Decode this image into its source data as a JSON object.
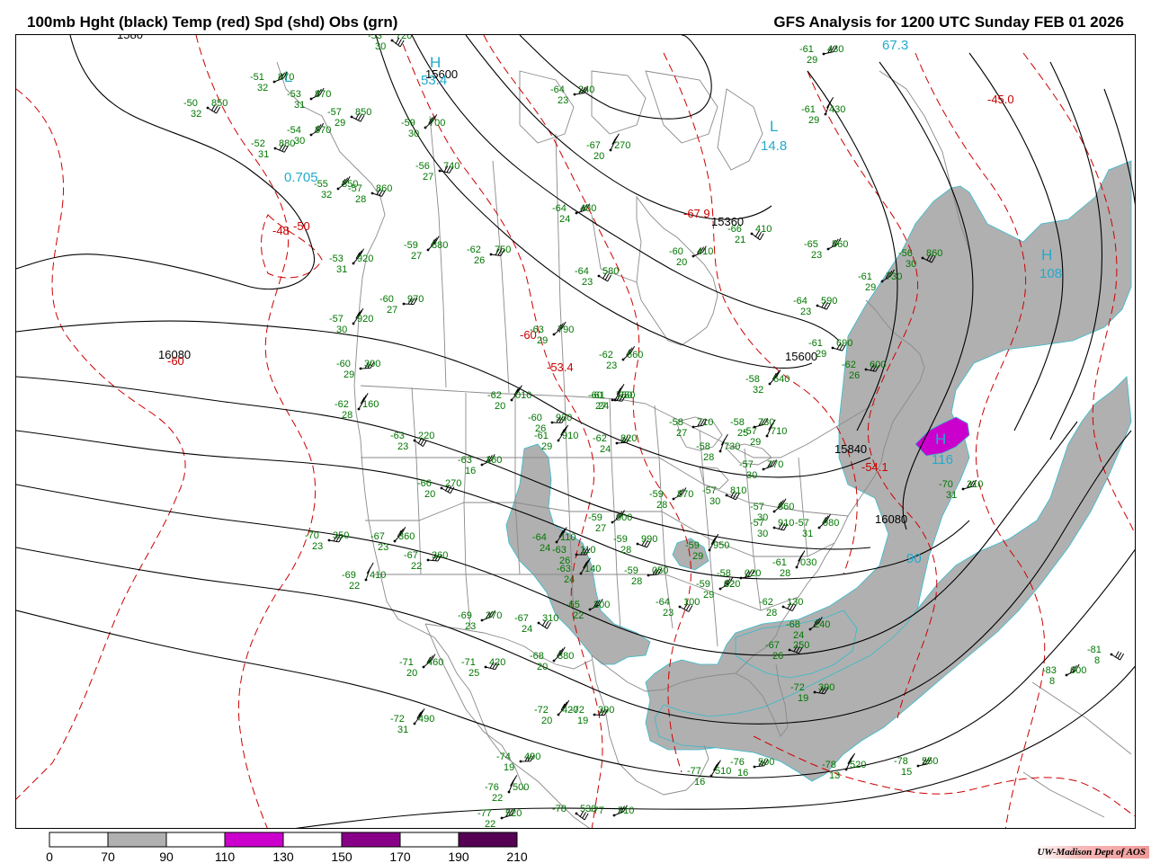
{
  "header": {
    "title_left": "100mb Hght (black) Temp (red) Spd (shd) Obs (grn)",
    "title_right": "GFS Analysis for 1200 UTC Sunday  FEB 01 2026"
  },
  "credit": "UW-Madison  Dept of AOS",
  "colors": {
    "height_contour": "#000000",
    "temp_contour": "#cc0000",
    "obs": "#007700",
    "center_label": "#22aacc",
    "boundaries": "#808080",
    "speed_70_90": "#b0b0b0",
    "speed_110_130": "#cc00cc",
    "speed_150_170": "#880088",
    "speed_190_210": "#550055"
  },
  "legend": {
    "labels": [
      "0",
      "70",
      "90",
      "110",
      "130",
      "150",
      "170",
      "190",
      "210"
    ],
    "bins": [
      {
        "range": "0-70",
        "color": "#ffffff"
      },
      {
        "range": "70-90",
        "color": "#b0b0b0"
      },
      {
        "range": "90-110",
        "color": "#ffffff"
      },
      {
        "range": "110-130",
        "color": "#cc00cc"
      },
      {
        "range": "130-150",
        "color": "#ffffff"
      },
      {
        "range": "150-170",
        "color": "#880088"
      },
      {
        "range": "170-190",
        "color": "#ffffff"
      },
      {
        "range": "190-210",
        "color": "#550055"
      }
    ]
  },
  "height_labels": [
    "15600",
    "15360",
    "15600",
    "15840",
    "16080",
    "16080",
    "1580"
  ],
  "temp_labels": [
    "-48",
    "-50",
    "-60",
    "-53.4",
    "-60",
    "-54.1",
    "-45.0",
    "-67.9",
    "-60"
  ],
  "centers": [
    {
      "kind": "L",
      "value": "0.705"
    },
    {
      "kind": "H",
      "value": "53.4"
    },
    {
      "kind": "L",
      "value": "14.8"
    },
    {
      "kind": "L",
      "value": "67.3"
    },
    {
      "kind": "H",
      "value": "108"
    },
    {
      "kind": "H",
      "value": "116"
    },
    {
      "kind": "L",
      "value": "90"
    }
  ],
  "observations": [
    {
      "t": "-53",
      "d": "30",
      "h": "720"
    },
    {
      "t": "-51",
      "d": "32",
      "h": "870"
    },
    {
      "t": "-50",
      "d": "32",
      "h": "850"
    },
    {
      "t": "-53",
      "d": "31",
      "h": "870"
    },
    {
      "t": "-57",
      "d": "29",
      "h": "850"
    },
    {
      "t": "-54",
      "d": "30",
      "h": "870"
    },
    {
      "t": "-52",
      "d": "31",
      "h": "880"
    },
    {
      "t": "-55",
      "d": "32",
      "h": "850"
    },
    {
      "t": "-57",
      "d": "28",
      "h": "860"
    },
    {
      "t": "-59",
      "d": "30",
      "h": "700"
    },
    {
      "t": "-56",
      "d": "27",
      "h": "740"
    },
    {
      "t": "-59",
      "d": "27",
      "h": "880"
    },
    {
      "t": "-62",
      "d": "26",
      "h": "750"
    },
    {
      "t": "-53",
      "d": "31",
      "h": "920"
    },
    {
      "t": "-60",
      "d": "27",
      "h": "970"
    },
    {
      "t": "-57",
      "d": "30",
      "h": "920"
    },
    {
      "t": "-60",
      "d": "29",
      "h": "300"
    },
    {
      "t": "-62",
      "d": "28",
      "h": "160"
    },
    {
      "t": "-64",
      "d": "23",
      "h": "240"
    },
    {
      "t": "-67",
      "d": "20",
      "h": "270"
    },
    {
      "t": "-61",
      "d": "29",
      "h": "430"
    },
    {
      "t": "-61",
      "d": "29",
      "h": "430"
    },
    {
      "t": "-64",
      "d": "24",
      "h": "480"
    },
    {
      "t": "-66",
      "d": "21",
      "h": "410"
    },
    {
      "t": "-60",
      "d": "20",
      "h": "410"
    },
    {
      "t": "-64",
      "d": "23",
      "h": "580"
    },
    {
      "t": "-65",
      "d": "23",
      "h": "560"
    },
    {
      "t": "-56",
      "d": "30",
      "h": "860"
    },
    {
      "t": "-61",
      "d": "29",
      "h": "730"
    },
    {
      "t": "-64",
      "d": "23",
      "h": "590"
    },
    {
      "t": "-63",
      "d": "29",
      "h": "790"
    },
    {
      "t": "-61",
      "d": "29",
      "h": "690"
    },
    {
      "t": "-62",
      "d": "23",
      "h": "660"
    },
    {
      "t": "-62",
      "d": "26",
      "h": "600"
    },
    {
      "t": "-58",
      "d": "32",
      "h": "640"
    },
    {
      "t": "-60",
      "d": "27",
      "h": "750"
    },
    {
      "t": "-62",
      "d": "20",
      "h": "010"
    },
    {
      "t": "-60",
      "d": "26",
      "h": "930"
    },
    {
      "t": "-61",
      "d": "29",
      "h": "910"
    },
    {
      "t": "-62",
      "d": "24",
      "h": "820"
    },
    {
      "t": "-61",
      "d": "24",
      "h": "750"
    },
    {
      "t": "-58",
      "d": "27",
      "h": "710"
    },
    {
      "t": "-57",
      "d": "29",
      "h": "710"
    },
    {
      "t": "-58",
      "d": "25",
      "h": "730"
    },
    {
      "t": "-58",
      "d": "28",
      "h": "730"
    },
    {
      "t": "-57",
      "d": "30",
      "h": "770"
    },
    {
      "t": "-63",
      "d": "23",
      "h": "220"
    },
    {
      "t": "-63",
      "d": "16",
      "h": "160"
    },
    {
      "t": "-66",
      "d": "20",
      "h": "270"
    },
    {
      "t": "-59",
      "d": "28",
      "h": "870"
    },
    {
      "t": "-57",
      "d": "30",
      "h": "810"
    },
    {
      "t": "-59",
      "d": "27",
      "h": "900"
    },
    {
      "t": "-59",
      "d": "28",
      "h": "990"
    },
    {
      "t": "-57",
      "d": "30",
      "h": "860"
    },
    {
      "t": "-57",
      "d": "30",
      "h": "910"
    },
    {
      "t": "-57",
      "d": "31",
      "h": "980"
    },
    {
      "t": "-70",
      "d": "23",
      "h": "350"
    },
    {
      "t": "-67",
      "d": "23",
      "h": "360"
    },
    {
      "t": "-67",
      "d": "22",
      "h": "360"
    },
    {
      "t": "-64",
      "d": "24",
      "h": "110"
    },
    {
      "t": "-63",
      "d": "26",
      "h": "110"
    },
    {
      "t": "-63",
      "d": "24",
      "h": "140"
    },
    {
      "t": "-59",
      "d": "28",
      "h": "050"
    },
    {
      "t": "-59",
      "d": "29",
      "h": "950"
    },
    {
      "t": "-58",
      "d": "32",
      "h": "020"
    },
    {
      "t": "-61",
      "d": "28",
      "h": "030"
    },
    {
      "t": "-70",
      "d": "31",
      "h": "310"
    },
    {
      "t": "-69",
      "d": "22",
      "h": "410"
    },
    {
      "t": "-69",
      "d": "23",
      "h": "370"
    },
    {
      "t": "-67",
      "d": "24",
      "h": "310"
    },
    {
      "t": "-65",
      "d": "22",
      "h": "200"
    },
    {
      "t": "-64",
      "d": "23",
      "h": "100"
    },
    {
      "t": "-59",
      "d": "29",
      "h": "020"
    },
    {
      "t": "-62",
      "d": "28",
      "h": "130"
    },
    {
      "t": "-68",
      "d": "24",
      "h": "240"
    },
    {
      "t": "-67",
      "d": "26",
      "h": "250"
    },
    {
      "t": "-71",
      "d": "20",
      "h": "460"
    },
    {
      "t": "-71",
      "d": "25",
      "h": "420"
    },
    {
      "t": "-68",
      "d": "20",
      "h": "380"
    },
    {
      "t": "-72",
      "d": "19",
      "h": "390"
    },
    {
      "t": "-72",
      "d": "20",
      "h": "420"
    },
    {
      "t": "-72",
      "d": "19",
      "h": "390"
    },
    {
      "t": "-72",
      "d": "31",
      "h": "490"
    },
    {
      "t": "-74",
      "d": "19",
      "h": "490"
    },
    {
      "t": "-77",
      "d": "16",
      "h": "510"
    },
    {
      "t": "-76",
      "d": "16",
      "h": "500"
    },
    {
      "t": "-78",
      "d": "13",
      "h": "520"
    },
    {
      "t": "-78",
      "d": "15",
      "h": "550"
    },
    {
      "t": "-76",
      "d": "22",
      "h": "500"
    },
    {
      "t": "-77",
      "d": "22",
      "h": "520"
    },
    {
      "t": "-78",
      "d": "",
      "h": "530"
    },
    {
      "t": "-77",
      "d": "",
      "h": "510"
    },
    {
      "t": "-81",
      "d": "8",
      "h": ""
    },
    {
      "t": "-83",
      "d": "8",
      "h": "600"
    }
  ]
}
